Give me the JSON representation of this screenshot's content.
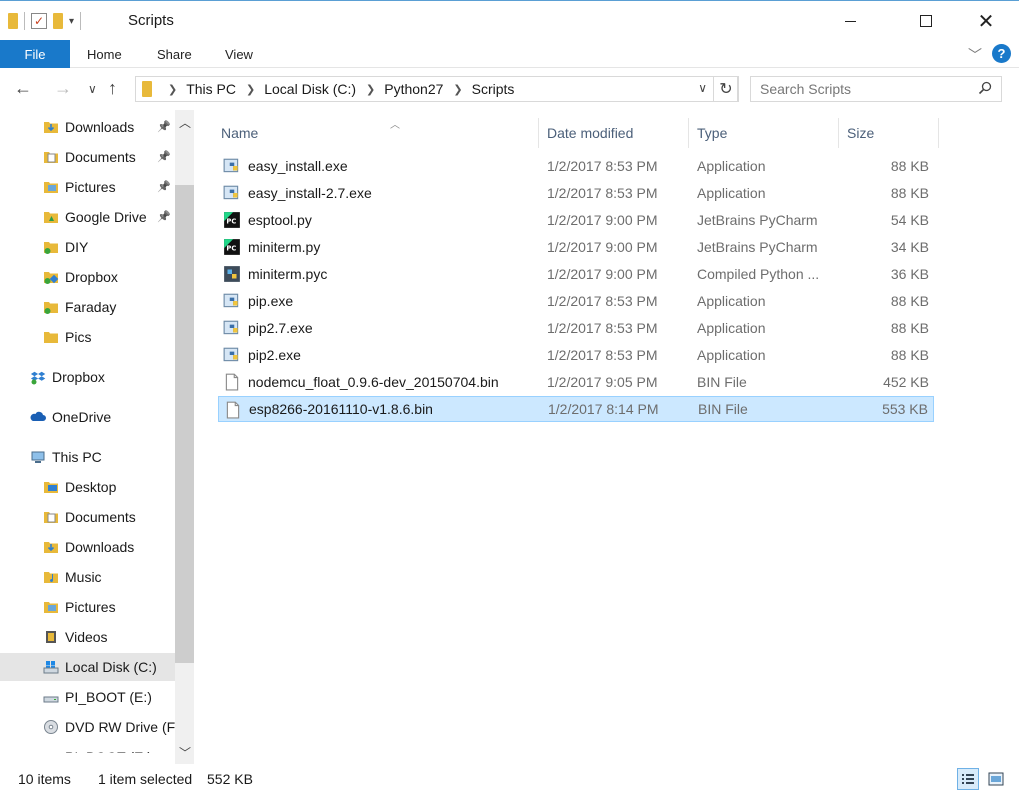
{
  "window": {
    "title": "Scripts"
  },
  "ribbon": {
    "file": "File",
    "home": "Home",
    "share": "Share",
    "view": "View",
    "help": "?"
  },
  "address": {
    "crumbs": [
      "This PC",
      "Local Disk (C:)",
      "Python27",
      "Scripts"
    ],
    "search_placeholder": "Search Scripts"
  },
  "sidebar": {
    "items": [
      {
        "label": "Downloads",
        "icon": "downloads-icon",
        "pinned": true
      },
      {
        "label": "Documents",
        "icon": "documents-icon",
        "pinned": true
      },
      {
        "label": "Pictures",
        "icon": "pictures-icon",
        "pinned": true
      },
      {
        "label": "Google Drive",
        "icon": "google-drive-icon",
        "pinned": true
      },
      {
        "label": "DIY",
        "icon": "folder-synced-icon",
        "pinned": false
      },
      {
        "label": "Dropbox",
        "icon": "folder-dropbox-icon",
        "pinned": false
      },
      {
        "label": "Faraday",
        "icon": "folder-synced-icon",
        "pinned": false
      },
      {
        "label": "Pics",
        "icon": "folder-icon",
        "pinned": false
      },
      {
        "label": "Dropbox",
        "icon": "dropbox-icon",
        "pinned": false
      },
      {
        "label": "OneDrive",
        "icon": "onedrive-icon",
        "pinned": false
      },
      {
        "label": "This PC",
        "icon": "this-pc-icon",
        "pinned": false
      },
      {
        "label": "Desktop",
        "icon": "desktop-icon",
        "pinned": false
      },
      {
        "label": "Documents",
        "icon": "documents-icon",
        "pinned": false
      },
      {
        "label": "Downloads",
        "icon": "downloads-icon",
        "pinned": false
      },
      {
        "label": "Music",
        "icon": "music-icon",
        "pinned": false
      },
      {
        "label": "Pictures",
        "icon": "pictures-icon",
        "pinned": false
      },
      {
        "label": "Videos",
        "icon": "videos-icon",
        "pinned": false
      },
      {
        "label": "Local Disk (C:)",
        "icon": "local-disk-icon",
        "pinned": false
      },
      {
        "label": "PI_BOOT (E:)",
        "icon": "drive-icon",
        "pinned": false
      },
      {
        "label": "DVD RW Drive (F",
        "icon": "dvd-drive-icon",
        "pinned": false
      },
      {
        "label": "PI_BOOT (E:)",
        "icon": "drive-icon",
        "pinned": false
      }
    ]
  },
  "columns": {
    "name": "Name",
    "date": "Date modified",
    "type": "Type",
    "size": "Size"
  },
  "files": [
    {
      "name": "easy_install.exe",
      "date": "1/2/2017 8:53 PM",
      "type": "Application",
      "size": "88 KB",
      "icon": "python-exe-icon"
    },
    {
      "name": "easy_install-2.7.exe",
      "date": "1/2/2017 8:53 PM",
      "type": "Application",
      "size": "88 KB",
      "icon": "python-exe-icon"
    },
    {
      "name": "esptool.py",
      "date": "1/2/2017 9:00 PM",
      "type": "JetBrains PyCharm",
      "size": "54 KB",
      "icon": "pycharm-icon"
    },
    {
      "name": "miniterm.py",
      "date": "1/2/2017 9:00 PM",
      "type": "JetBrains PyCharm",
      "size": "34 KB",
      "icon": "pycharm-icon"
    },
    {
      "name": "miniterm.pyc",
      "date": "1/2/2017 9:00 PM",
      "type": "Compiled Python ...",
      "size": "36 KB",
      "icon": "compiled-python-icon"
    },
    {
      "name": "pip.exe",
      "date": "1/2/2017 8:53 PM",
      "type": "Application",
      "size": "88 KB",
      "icon": "python-exe-icon"
    },
    {
      "name": "pip2.7.exe",
      "date": "1/2/2017 8:53 PM",
      "type": "Application",
      "size": "88 KB",
      "icon": "python-exe-icon"
    },
    {
      "name": "pip2.exe",
      "date": "1/2/2017 8:53 PM",
      "type": "Application",
      "size": "88 KB",
      "icon": "python-exe-icon"
    },
    {
      "name": "nodemcu_float_0.9.6-dev_20150704.bin",
      "date": "1/2/2017 9:05 PM",
      "type": "BIN File",
      "size": "452 KB",
      "icon": "file-icon"
    },
    {
      "name": "esp8266-20161110-v1.8.6.bin",
      "date": "1/2/2017 8:14 PM",
      "type": "BIN File",
      "size": "553 KB",
      "icon": "file-icon",
      "selected": true
    }
  ],
  "status": {
    "count": "10 items",
    "selected": "1 item selected",
    "size": "552 KB"
  },
  "colors": {
    "accent": "#1979ca",
    "selection": "#cce8ff",
    "selection_border": "#99d1ff",
    "folder": "#e8b93a"
  }
}
